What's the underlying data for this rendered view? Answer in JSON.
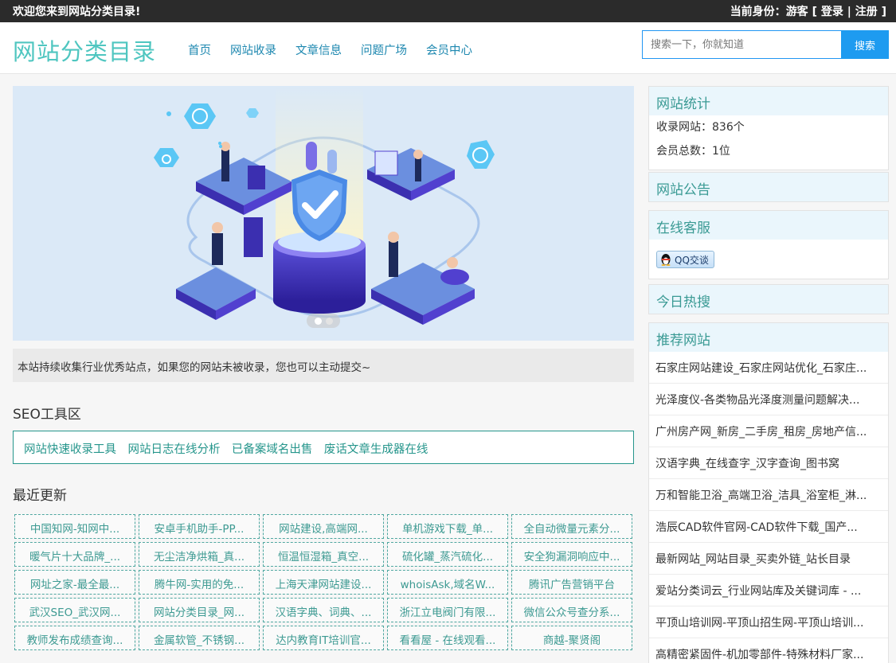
{
  "topbar": {
    "welcome": "欢迎您来到网站分类目录!",
    "identity_label": "当前身份：",
    "guest": "游客",
    "bracket_open": "[",
    "login": "登录",
    "divider": "|",
    "register": "注册",
    "bracket_close": "]"
  },
  "header": {
    "logo": "网站分类目录",
    "nav": [
      "首页",
      "网站收录",
      "文章信息",
      "问题广场",
      "会员中心"
    ],
    "search_placeholder": "搜索一下，你就知道",
    "search_button": "搜索"
  },
  "banner": {
    "slides": 2,
    "active_slide": 1
  },
  "notice": "本站持续收集行业优秀站点，如果您的网站未被收录，您也可以主动提交~",
  "seo": {
    "title": "SEO工具区",
    "links": [
      "网站快速收录工具",
      "网站日志在线分析",
      "已备案域名出售",
      "废话文章生成器在线"
    ]
  },
  "recent": {
    "title": "最近更新",
    "items": [
      "中国知网-知网中...",
      "安卓手机助手-PP...",
      "网站建设,高端网...",
      "单机游戏下载_单...",
      "全自动微量元素分...",
      "暖气片十大品牌_...",
      "无尘洁净烘箱_真...",
      "恒温恒湿箱_真空...",
      "硫化罐_蒸汽硫化...",
      "安全狗漏洞响应中...",
      "网址之家-最全最...",
      "腾牛网-实用的免...",
      "上海天津网站建设...",
      "whoisAsk,域名W...",
      "腾讯广告营销平台",
      "武汉SEO_武汉网...",
      "网站分类目录_网...",
      "汉语字典、词典、...",
      "浙江立电阀门有限...",
      "微信公众号查分系...",
      "教师发布成绩查询...",
      "金属软管_不锈钢...",
      "达内教育IT培训官...",
      "看看屋 - 在线观看...",
      "商越-聚贤阁"
    ]
  },
  "sidebar": {
    "stats": {
      "title": "网站统计",
      "sites": "收录网站：836个",
      "members": "会员总数：1位"
    },
    "announce": {
      "title": "网站公告"
    },
    "service": {
      "title": "在线客服",
      "qq_button": "QQ交谈"
    },
    "hot": {
      "title": "今日热搜"
    },
    "recommend": {
      "title": "推荐网站",
      "items": [
        "石家庄网站建设_石家庄网站优化_石家庄...",
        "光泽度仪-各类物品光泽度测量问题解决...",
        "广州房产网_新房_二手房_租房_房地产信...",
        "汉语字典_在线查字_汉字查询_图书窝",
        "万和智能卫浴_高端卫浴_洁具_浴室柜_淋...",
        "浩辰CAD软件官网-CAD软件下载_国产...",
        "最新网站_网站目录_买卖外链_站长目录",
        "爱站分类词云_行业网站库及关键词库 - ...",
        "平顶山培训网-平顶山招生网-平顶山培训...",
        "高精密紧固件-机加零部件-特殊材料厂家..."
      ]
    }
  },
  "colors": {
    "accent": "#4fc6c0",
    "link": "#1e88b0",
    "teal": "#26968c",
    "search_button": "#1e9bf0",
    "topbar": "#2b2b2b"
  }
}
